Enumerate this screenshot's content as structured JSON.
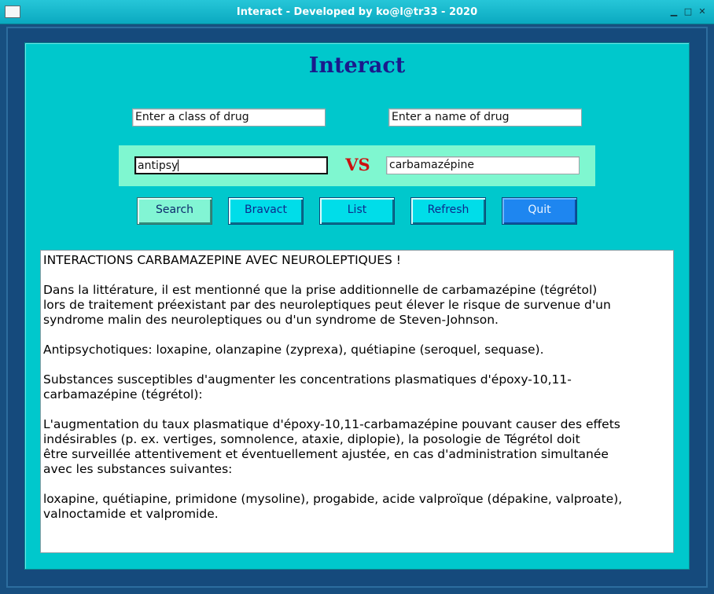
{
  "window": {
    "title": "Interact - Developed by ko@l@tr33 - 2020",
    "minimize_glyph": "▁",
    "maximize_glyph": "□",
    "close_glyph": "✕"
  },
  "app": {
    "heading": "Interact"
  },
  "form": {
    "class_label": "Enter a class of drug",
    "name_label": "Enter a name of drug",
    "class_value": "antipsy",
    "vs_label": "VS",
    "name_value": "carbamazépine"
  },
  "buttons": {
    "search": "Search",
    "bravact": "Bravact",
    "list": "List",
    "refresh": "Refresh",
    "quit": "Quit"
  },
  "output": {
    "lines": [
      "INTERACTIONS CARBAMAZEPINE AVEC NEUROLEPTIQUES !",
      "",
      "Dans la littérature, il est mentionné que la prise additionnelle de carbamazépine (tégrétol)",
      "lors de traitement préexistant par des neuroleptiques peut élever le risque de survenue d'un",
      "syndrome malin des neuroleptiques ou d'un syndrome de Steven-Johnson.",
      "",
      "Antipsychotiques: loxapine, olanzapine (zyprexa), quétiapine (seroquel, sequase).",
      "",
      "Substances susceptibles d'augmenter les concentrations plasmatiques d'époxy-10,11-",
      "carbamazépine (tégrétol):",
      "",
      "L'augmentation du taux plasmatique d'époxy-10,11-carbamazépine pouvant causer des effets",
      "indésirables (p. ex. vertiges, somnolence, ataxie, diplopie), la posologie de Tégrétol doit",
      "être surveillée attentivement et éventuellement ajustée, en cas d'administration simultanée",
      "avec les substances suivantes:",
      "",
      "loxapine, quétiapine, primidone (mysoline), progabide, acide valproïque (dépakine, valproate),",
      "valnoctamide et valpromide."
    ]
  },
  "colors": {
    "panel": "#00c8cc",
    "band": "#7ff7d0",
    "heading": "#1a1a8c",
    "vs": "#cc1010",
    "quit_button": "#1e86f0"
  }
}
